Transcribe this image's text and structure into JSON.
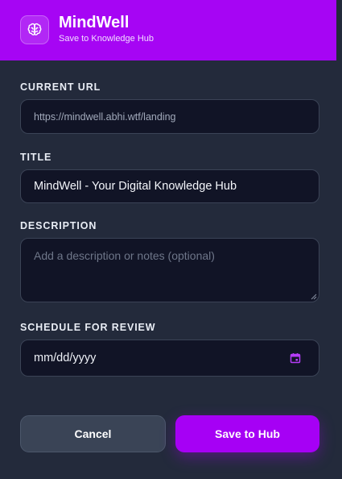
{
  "header": {
    "app_name": "MindWell",
    "subtitle": "Save to Knowledge Hub",
    "logo_icon": "brain-icon",
    "background": "#a605f4"
  },
  "form": {
    "url": {
      "label": "CURRENT URL",
      "value": "https://mindwell.abhi.wtf/landing"
    },
    "title": {
      "label": "TITLE",
      "value": "MindWell - Your Digital Knowledge Hub"
    },
    "description": {
      "label": "DESCRIPTION",
      "placeholder": "Add a description or notes (optional)"
    },
    "review": {
      "label": "SCHEDULE FOR REVIEW",
      "placeholder": "mm/dd/yyyy",
      "icon": "calendar-icon"
    }
  },
  "actions": {
    "cancel_label": "Cancel",
    "save_label": "Save to Hub",
    "accent_color": "#a600f5"
  }
}
